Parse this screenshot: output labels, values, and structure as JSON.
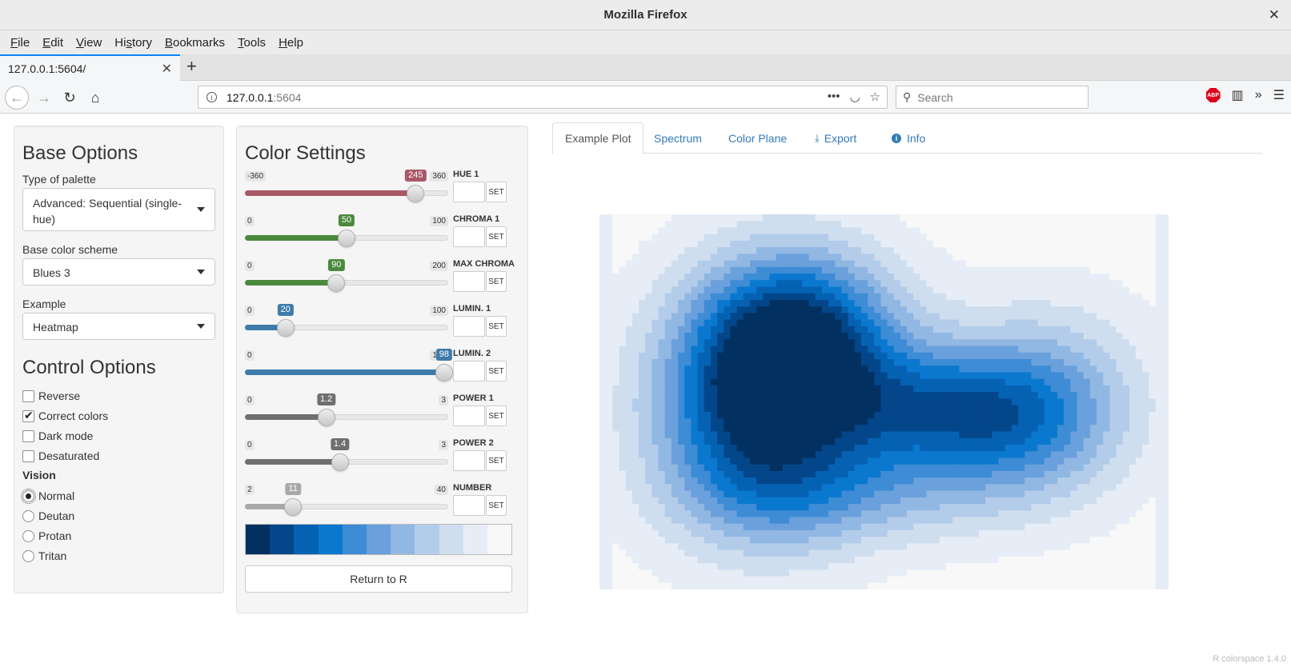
{
  "window": {
    "title": "Mozilla Firefox",
    "close_glyph": "✕"
  },
  "menu": [
    {
      "pre": "",
      "u": "F",
      "post": "ile"
    },
    {
      "pre": "",
      "u": "E",
      "post": "dit"
    },
    {
      "pre": "",
      "u": "V",
      "post": "iew"
    },
    {
      "pre": "Hi",
      "u": "s",
      "post": "tory"
    },
    {
      "pre": "",
      "u": "B",
      "post": "ookmarks"
    },
    {
      "pre": "",
      "u": "T",
      "post": "ools"
    },
    {
      "pre": "",
      "u": "H",
      "post": "elp"
    }
  ],
  "tab": {
    "title": "127.0.0.1:5604/"
  },
  "url": {
    "host": "127.0.0.1",
    "port": ":5604"
  },
  "search": {
    "placeholder": "Search"
  },
  "abp_label": "ABP",
  "base": {
    "heading": "Base Options",
    "type_label": "Type of palette",
    "type_value": "Advanced: Sequential (single-hue)",
    "scheme_label": "Base color scheme",
    "scheme_value": "Blues 3",
    "example_label": "Example",
    "example_value": "Heatmap"
  },
  "control": {
    "heading": "Control Options",
    "checkboxes": [
      {
        "label": "Reverse",
        "checked": false
      },
      {
        "label": "Correct colors",
        "checked": true
      },
      {
        "label": "Dark mode",
        "checked": false
      },
      {
        "label": "Desaturated",
        "checked": false
      }
    ],
    "vision_label": "Vision",
    "vision": [
      {
        "label": "Normal",
        "checked": true
      },
      {
        "label": "Deutan",
        "checked": false
      },
      {
        "label": "Protan",
        "checked": false
      },
      {
        "label": "Tritan",
        "checked": false
      }
    ]
  },
  "color_settings": {
    "heading": "Color Settings",
    "set_label": "SET",
    "sliders": [
      {
        "name": "HUE 1",
        "min": "-360",
        "max": "360",
        "value": "245",
        "fraction": 0.84,
        "color": "#a95868"
      },
      {
        "name": "CHROMA 1",
        "min": "0",
        "max": "100",
        "value": "50",
        "fraction": 0.5,
        "color": "#4b8a3e"
      },
      {
        "name": "MAX CHROMA",
        "min": "0",
        "max": "200",
        "value": "90",
        "fraction": 0.45,
        "color": "#4b8a3e"
      },
      {
        "name": "LUMIN. 1",
        "min": "0",
        "max": "100",
        "value": "20",
        "fraction": 0.2,
        "color": "#3e7bab"
      },
      {
        "name": "LUMIN. 2",
        "min": "0",
        "max": "100",
        "value": "98",
        "fraction": 0.98,
        "color": "#3e7bab"
      },
      {
        "name": "POWER 1",
        "min": "0",
        "max": "3",
        "value": "1.2",
        "fraction": 0.4,
        "color": "#6f6f6f"
      },
      {
        "name": "POWER 2",
        "min": "0",
        "max": "3",
        "value": "1.4",
        "fraction": 0.4667,
        "color": "#6f6f6f"
      },
      {
        "name": "NUMBER",
        "min": "2",
        "max": "40",
        "value": "11",
        "fraction": 0.2368,
        "color": "#a9a9a9"
      }
    ],
    "palette": [
      "#023061",
      "#03468a",
      "#0562b3",
      "#0b78cf",
      "#3d8cd5",
      "#6aa0dc",
      "#91b7e3",
      "#b3ccea",
      "#cfdeef",
      "#e6edf6",
      "#f8f8f8"
    ],
    "return_label": "Return to R"
  },
  "tabs": [
    {
      "label": "Example Plot",
      "icon": ""
    },
    {
      "label": "Spectrum",
      "icon": ""
    },
    {
      "label": "Color Plane",
      "icon": ""
    },
    {
      "label": "Export",
      "icon": "download-icon"
    },
    {
      "label": "Info",
      "icon": "info-icon"
    }
  ],
  "version": "R colorspace 1.4.0"
}
